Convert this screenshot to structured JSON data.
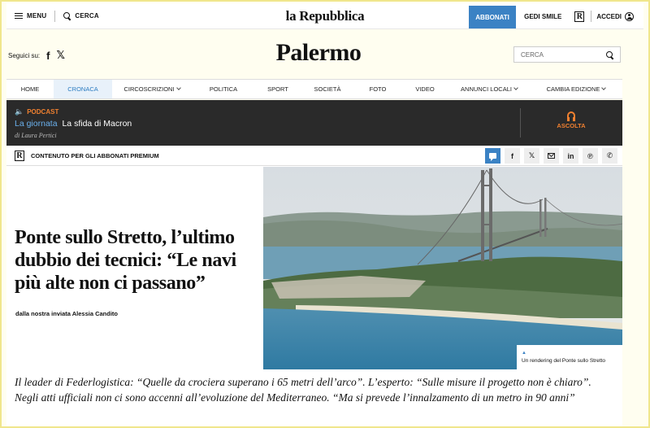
{
  "topbar": {
    "menu_label": "MENU",
    "search_label": "CERCA",
    "logo": "la Repubblica",
    "subscribe_label": "ABBONATI",
    "gedi_label": "GEDI SMILE",
    "r_logo": "R",
    "login_label": "ACCEDI"
  },
  "header": {
    "follow_label": "Seguici su:",
    "facebook": "f",
    "x": "𝕏",
    "section_title": "Palermo",
    "search_placeholder": "CERCA"
  },
  "nav": {
    "items": [
      {
        "label": "HOME"
      },
      {
        "label": "CRONACA",
        "active": true
      },
      {
        "label": "CIRCOSCRIZIONI",
        "dropdown": true
      },
      {
        "label": "POLITICA"
      },
      {
        "label": "SPORT"
      },
      {
        "label": "SOCIETÀ"
      },
      {
        "label": "FOTO"
      },
      {
        "label": "VIDEO"
      },
      {
        "label": "ANNUNCI LOCALI",
        "dropdown": true
      },
      {
        "label": "CAMBIA EDIZIONE",
        "dropdown": true
      }
    ]
  },
  "podcast": {
    "label": "PODCAST",
    "category": "La giornata",
    "title": "La sfida di Macron",
    "author": "di Laura Pertici",
    "listen_label": "ASCOLTA"
  },
  "premium": {
    "r_logo": "R",
    "label": "CONTENUTO PER GLI ABBONATI PREMIUM",
    "share": {
      "facebook": "f",
      "x": "𝕏",
      "linkedin": "in",
      "pinterest": "℗",
      "whatsapp": "✆"
    }
  },
  "article": {
    "headline": "Ponte sullo Stretto, l’ultimo dubbio dei tecnici: “Le navi più alte non ci passano”",
    "byline": "dalla nostra inviata Alessia Candito",
    "caption": "Un rendering del Ponte sullo Stretto",
    "summary": "Il leader di Federlogistica: “Quelle da crociera superano i 65 metri dell’arco”. L’esperto: “Sulle misure il progetto non è chiaro”. Negli atti ufficiali non ci sono accenni all’evoluzione del Mediterraneo. “Ma si prevede l’innalzamento di un metro in 90 anni”"
  },
  "colors": {
    "accent": "#3b82c4",
    "podcast_bg": "#2a2a2a",
    "podcast_accent": "#f08030"
  }
}
